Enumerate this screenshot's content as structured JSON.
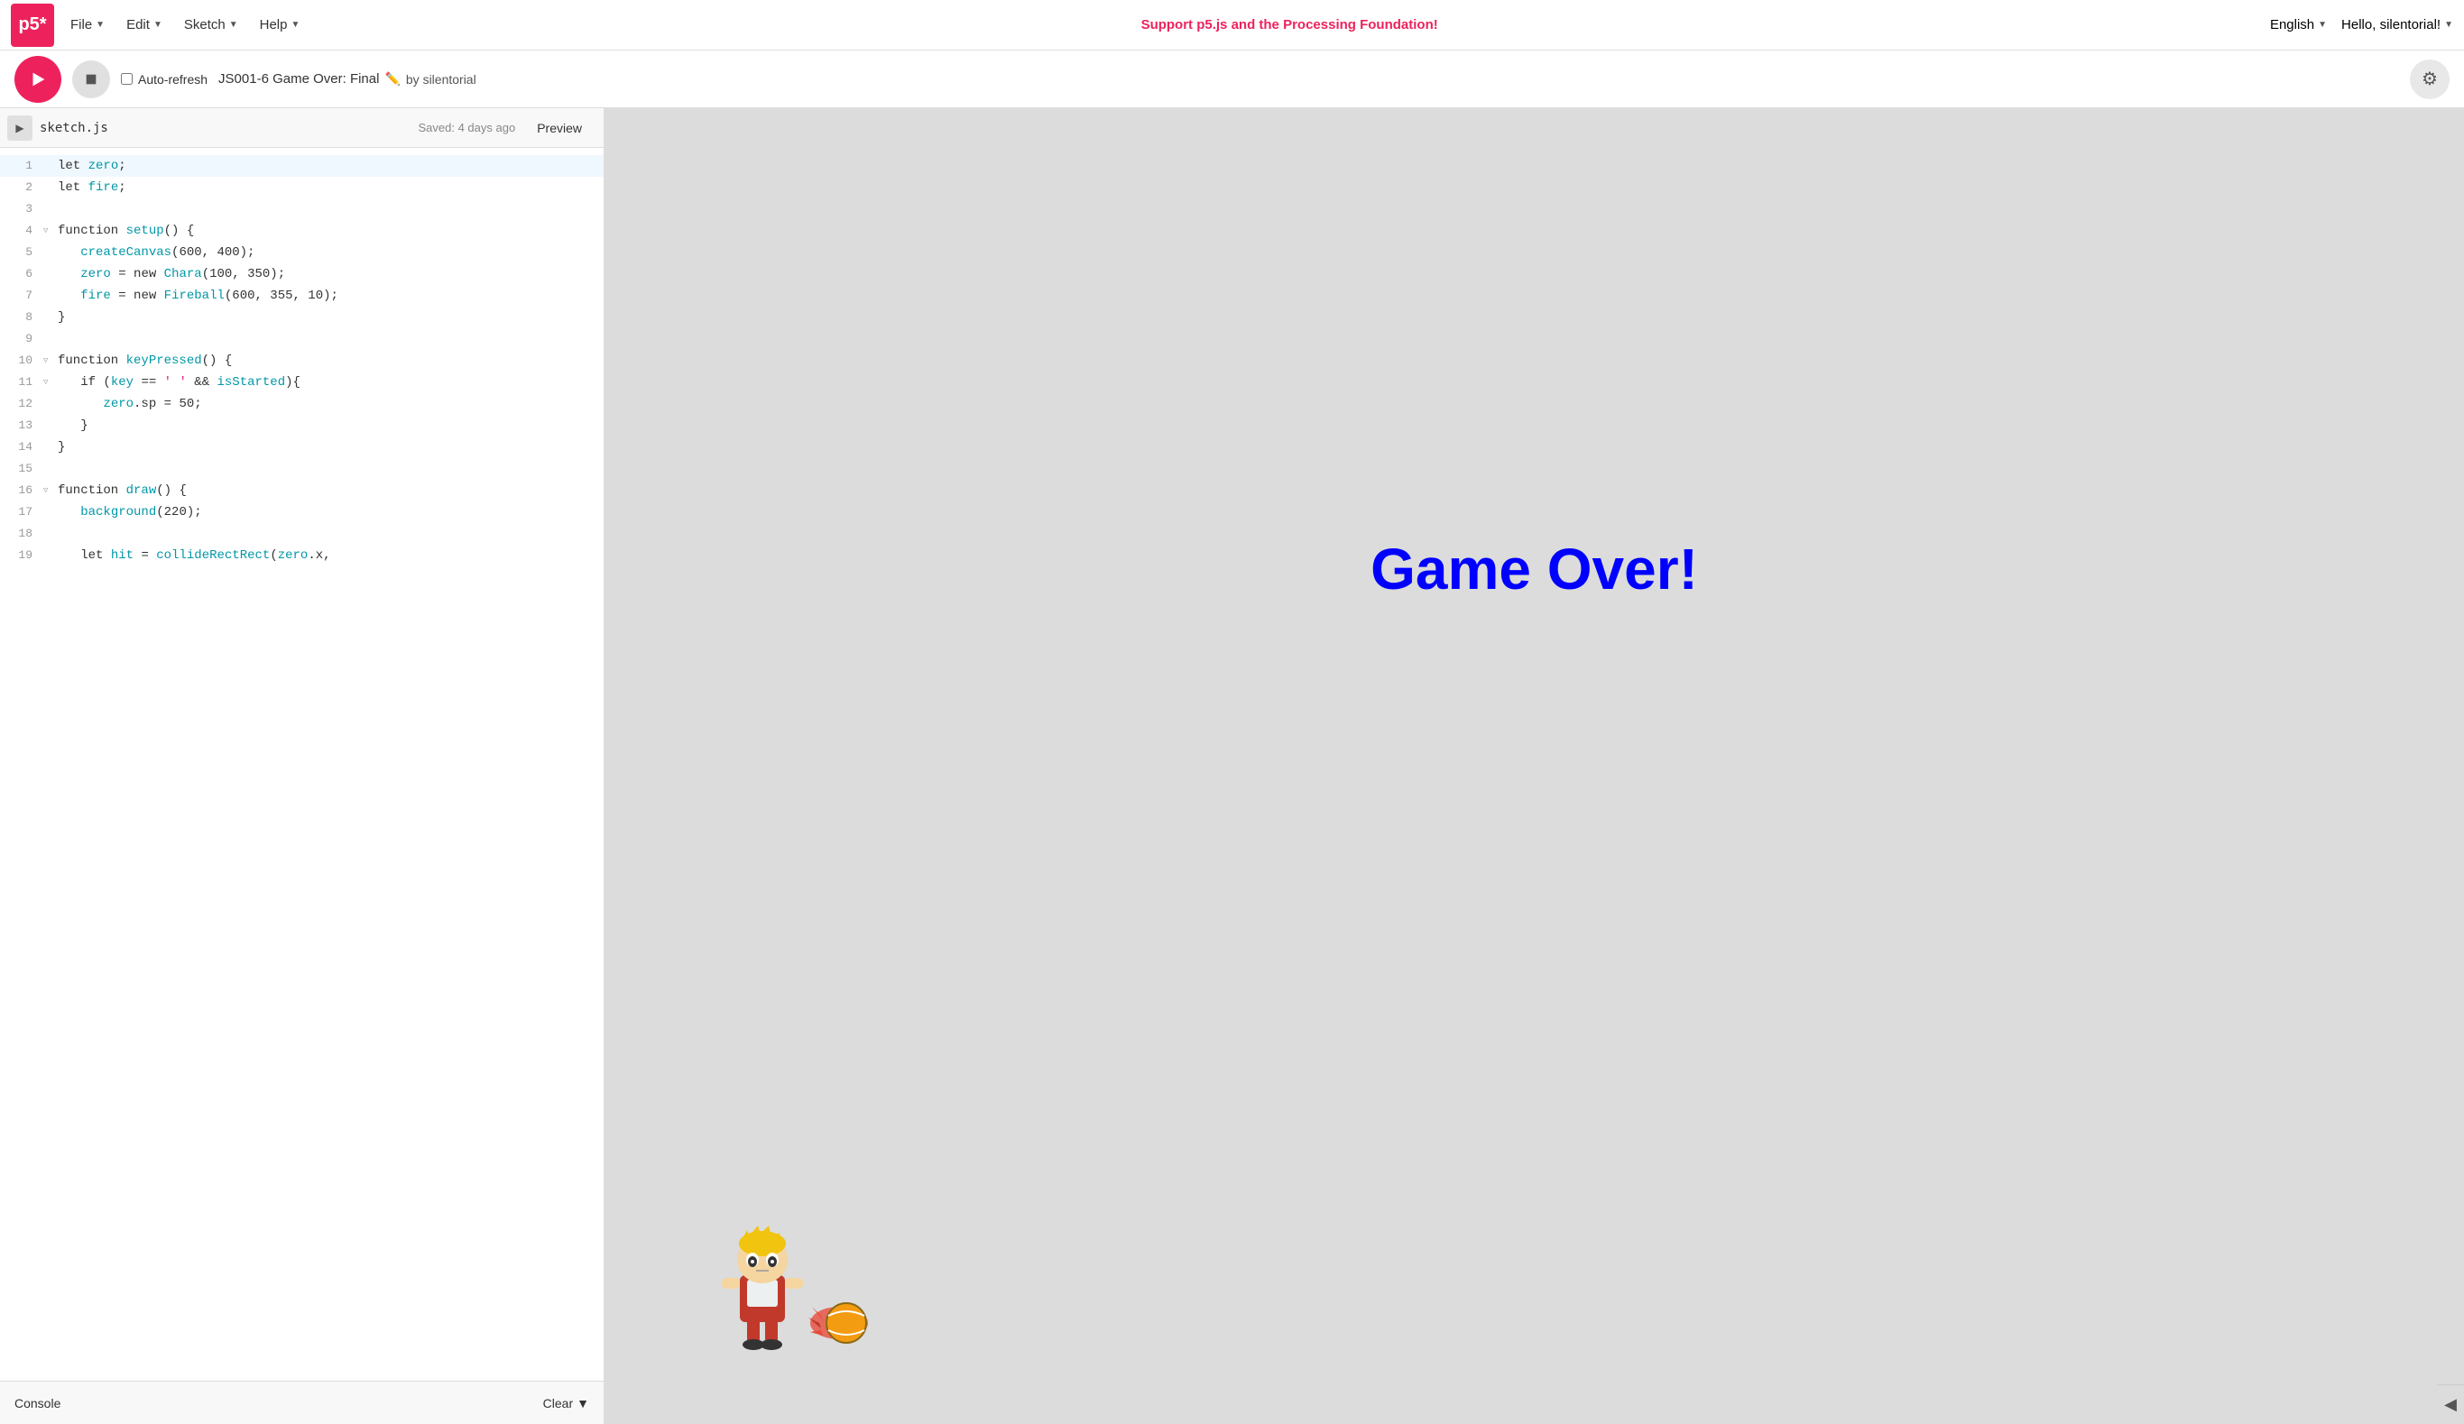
{
  "nav": {
    "logo": "p5*",
    "file_label": "File",
    "edit_label": "Edit",
    "sketch_label": "Sketch",
    "help_label": "Help",
    "support_text": "Support p5.js and the Processing Foundation!",
    "lang_label": "English",
    "user_label": "Hello, silentorial!"
  },
  "toolbar": {
    "autorefresh_label": "Auto-refresh",
    "sketch_title": "JS001-6 Game Over: Final",
    "by_label": "by silentorial",
    "play_title": "Play",
    "stop_title": "Stop",
    "settings_title": "Settings"
  },
  "editor": {
    "tab_name": "sketch.js",
    "saved_text": "Saved: 4 days ago",
    "preview_label": "Preview",
    "code_lines": [
      {
        "num": 1,
        "fold": "",
        "content": "let zero;",
        "highlight": true
      },
      {
        "num": 2,
        "fold": "",
        "content": "let fire;",
        "highlight": false
      },
      {
        "num": 3,
        "fold": "",
        "content": "",
        "highlight": false
      },
      {
        "num": 4,
        "fold": "▽",
        "content": "function setup() {",
        "highlight": false
      },
      {
        "num": 5,
        "fold": "",
        "content": "  createCanvas(600, 400);",
        "highlight": false
      },
      {
        "num": 6,
        "fold": "",
        "content": "  zero = new Chara(100, 350);",
        "highlight": false
      },
      {
        "num": 7,
        "fold": "",
        "content": "  fire = new Fireball(600, 355, 10);",
        "highlight": false
      },
      {
        "num": 8,
        "fold": "",
        "content": "}",
        "highlight": false
      },
      {
        "num": 9,
        "fold": "",
        "content": "",
        "highlight": false
      },
      {
        "num": 10,
        "fold": "▽",
        "content": "function keyPressed() {",
        "highlight": false
      },
      {
        "num": 11,
        "fold": "▽",
        "content": "  if (key == ' ' && isStarted){",
        "highlight": false
      },
      {
        "num": 12,
        "fold": "",
        "content": "    zero.sp = 50;",
        "highlight": false
      },
      {
        "num": 13,
        "fold": "",
        "content": "  }",
        "highlight": false
      },
      {
        "num": 14,
        "fold": "",
        "content": "}",
        "highlight": false
      },
      {
        "num": 15,
        "fold": "",
        "content": "",
        "highlight": false
      },
      {
        "num": 16,
        "fold": "▽",
        "content": "function draw() {",
        "highlight": false
      },
      {
        "num": 17,
        "fold": "",
        "content": "  background(220);",
        "highlight": false
      },
      {
        "num": 18,
        "fold": "",
        "content": "",
        "highlight": false
      },
      {
        "num": 19,
        "fold": "",
        "content": "  let hit = collideRectRect(zero.x,",
        "highlight": false
      }
    ]
  },
  "console": {
    "label": "Console",
    "clear_label": "Clear"
  },
  "preview": {
    "game_over_text": "Game Over!"
  }
}
